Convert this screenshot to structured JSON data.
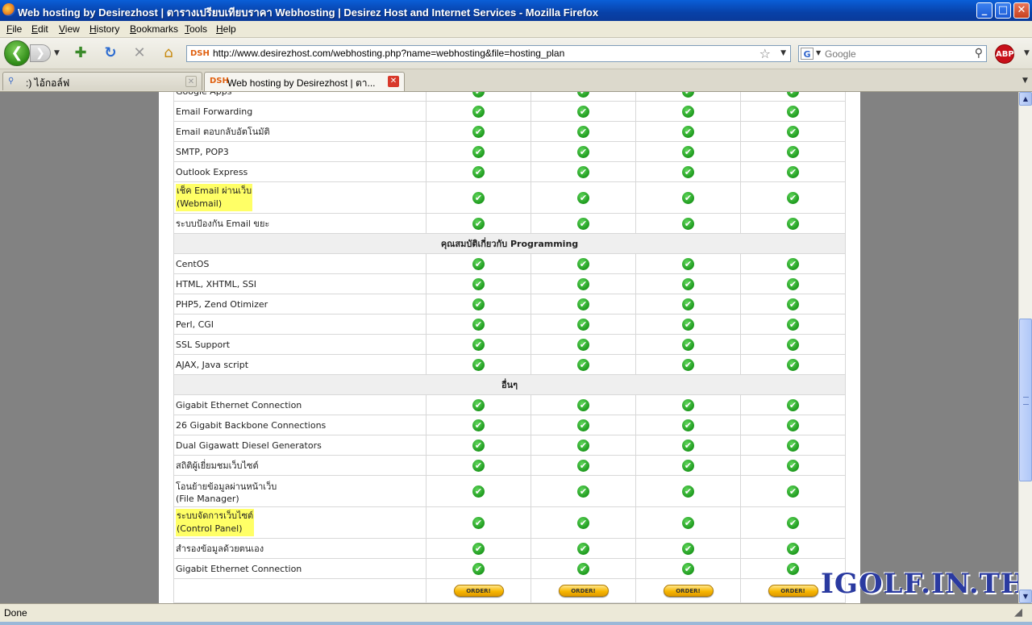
{
  "window": {
    "title": "Web hosting by Desirezhost | ตารางเปรียบเทียบราคา Webhosting | Desirez Host and Internet Services - Mozilla Firefox",
    "minimize": "_",
    "maximize": "□",
    "close": "✕"
  },
  "menu": [
    "File",
    "Edit",
    "View",
    "History",
    "Bookmarks",
    "Tools",
    "Help"
  ],
  "nav": {
    "url": "http://www.desirezhost.com/webhosting.php?name=webhosting&file=hosting_plan",
    "site_icon": "DSH",
    "search_engine_icon": "G",
    "search_placeholder": "Google",
    "addon_badge": "ABP"
  },
  "tabs": [
    {
      "label": ":) ไอ้กอล์ฟ",
      "icon": "search-icon",
      "active": false
    },
    {
      "label": "Web hosting by Desirezhost | ตา...",
      "icon": "DSH",
      "active": true
    }
  ],
  "table": {
    "rows_email": [
      {
        "label": "Google Apps"
      },
      {
        "label": "Email Forwarding"
      },
      {
        "label": "Email ตอบกลับอัตโนมัติ"
      },
      {
        "label": "SMTP, POP3"
      },
      {
        "label": "Outlook Express"
      },
      {
        "label_line1": "เช็ค Email ผ่านเว็บ",
        "label_line2": "(Webmail)",
        "highlight": true
      },
      {
        "label": "ระบบป้องกัน Email ขยะ"
      }
    ],
    "section_programming": "คุณสมบัติเกี่ยวกับ Programming",
    "rows_programming": [
      {
        "label": "CentOS"
      },
      {
        "label": "HTML, XHTML, SSI"
      },
      {
        "label": "PHP5, Zend Otimizer"
      },
      {
        "label": "Perl, CGI"
      },
      {
        "label": "SSL Support"
      },
      {
        "label": "AJAX, Java script"
      }
    ],
    "section_other": "อื่นๆ",
    "rows_other": [
      {
        "label": "Gigabit Ethernet Connection"
      },
      {
        "label": "26 Gigabit Backbone Connections"
      },
      {
        "label": "Dual Gigawatt Diesel Generators"
      },
      {
        "label": "สถิติผู้เยี่ยมชมเว็บไซต์"
      },
      {
        "label_line1": "โอนย้ายข้อมูลผ่านหน้าเว็บ",
        "label_line2": "(File Manager)"
      },
      {
        "label_line1": "ระบบจัดการเว็บไซต์",
        "label_line2": "(Control Panel)",
        "highlight": true
      },
      {
        "label": "สำรองข้อมูลด้วยตนเอง"
      },
      {
        "label": "Gigabit Ethernet Connection"
      }
    ],
    "check_symbol": "✔",
    "order_label": "ORDER!"
  },
  "watermark": "IGOLF.IN.TH",
  "status": "Done"
}
